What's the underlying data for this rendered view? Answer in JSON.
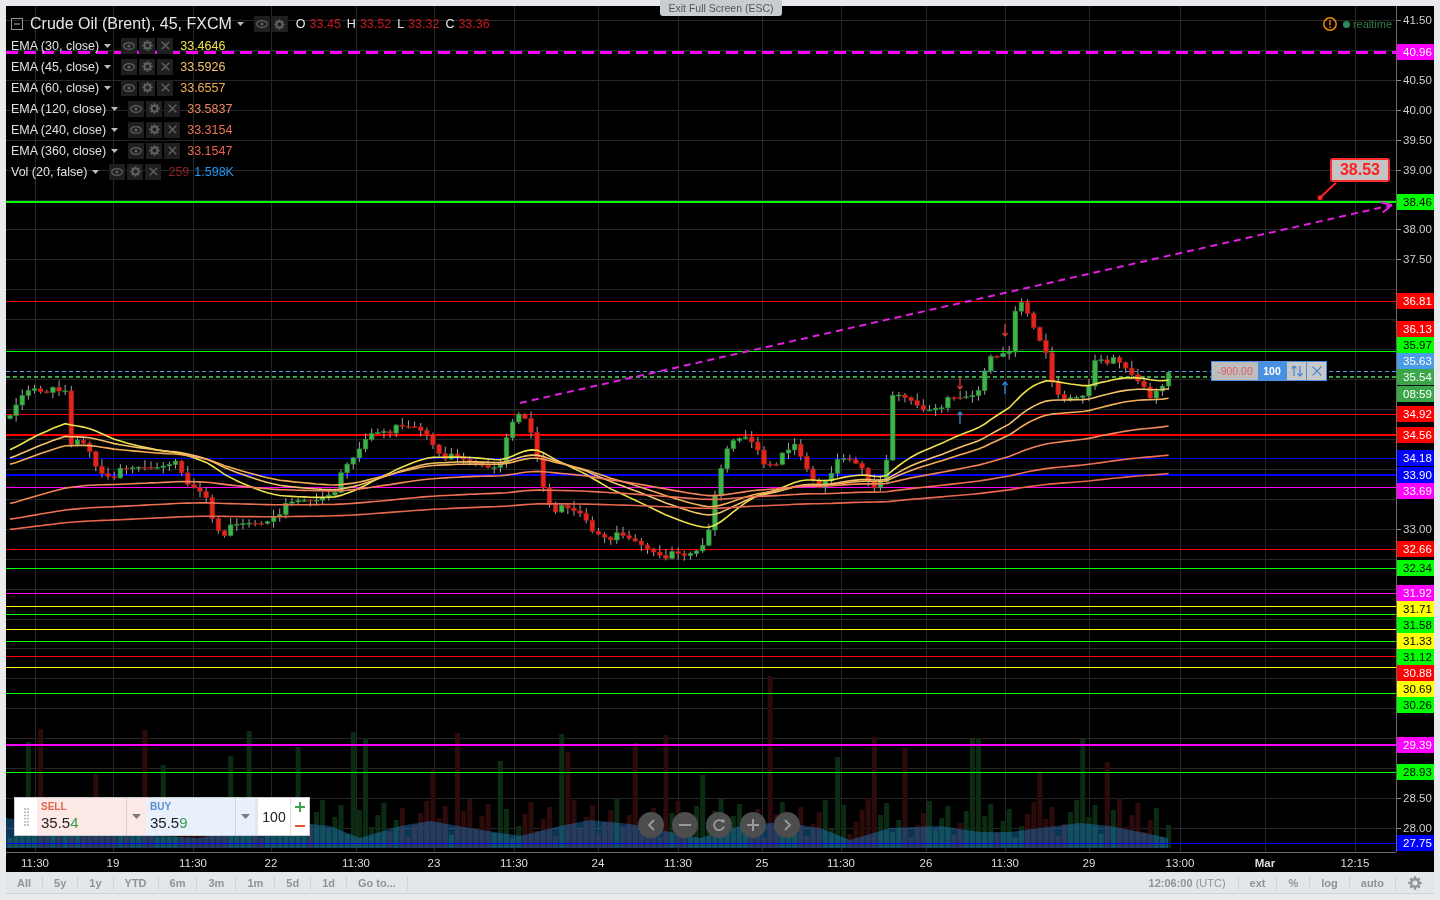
{
  "exit_fullscreen": "Exit Full Screen (ESC)",
  "legend": {
    "title": "Crude Oil (Brent), 45, FXCM",
    "ohlc": [
      {
        "label": "O",
        "value": "33.45"
      },
      {
        "label": "H",
        "value": "33.52"
      },
      {
        "label": "L",
        "value": "33.32"
      },
      {
        "label": "C",
        "value": "33.36"
      }
    ],
    "indicators": [
      {
        "name": "EMA (30, close)",
        "kind": "ema",
        "values": [
          {
            "text": "33.4646",
            "color": "#eee34a"
          }
        ]
      },
      {
        "name": "EMA (45, close)",
        "kind": "ema",
        "values": [
          {
            "text": "33.5926",
            "color": "#f4c06a"
          }
        ]
      },
      {
        "name": "EMA (60, close)",
        "kind": "ema",
        "values": [
          {
            "text": "33.6557",
            "color": "#f3ad58"
          }
        ]
      },
      {
        "name": "EMA (120, close)",
        "kind": "ema",
        "values": [
          {
            "text": "33.5837",
            "color": "#f2845a"
          }
        ]
      },
      {
        "name": "EMA (240, close)",
        "kind": "ema",
        "values": [
          {
            "text": "33.3154",
            "color": "#ee7052"
          }
        ]
      },
      {
        "name": "EMA (360, close)",
        "kind": "ema",
        "values": [
          {
            "text": "33.1547",
            "color": "#e8664e"
          }
        ]
      },
      {
        "name": "Vol (20, false)",
        "kind": "volume",
        "values": [
          {
            "text": "259",
            "color": "#8e2424"
          },
          {
            "text": "1.598K",
            "color": "#2196f3"
          }
        ]
      }
    ]
  },
  "status": {
    "text": "realtime"
  },
  "callout": {
    "text": "38.53"
  },
  "order": {
    "pnl": "-900.00",
    "quantity": "100"
  },
  "price_axis": {
    "ticks": [
      "41.50",
      "40.50",
      "40.00",
      "39.50",
      "39.00",
      "38.00",
      "37.50",
      "33.00",
      "28.50",
      "28.00"
    ]
  },
  "price_levels": [
    {
      "price": "40.96",
      "color": "#ff00ff",
      "kind": "dashed"
    },
    {
      "price": "38.46",
      "color": "#00ff00",
      "kind": "bold"
    },
    {
      "price": "36.81",
      "color": "#ff0000",
      "kind": "thin"
    },
    {
      "price": "36.13",
      "color": "#ff0000",
      "kind": "label"
    },
    {
      "price": "35.97",
      "color": "#00ff00",
      "kind": "thin"
    },
    {
      "price": "35.63",
      "color": "#4a9be6",
      "kind": "order"
    },
    {
      "price": "35.54",
      "color": "#3aa648",
      "kind": "last",
      "countdown": "08:59"
    },
    {
      "price": "34.92",
      "color": "#ff0000",
      "kind": "thin"
    },
    {
      "price": "34.56",
      "color": "#ff0000",
      "kind": "bold"
    },
    {
      "price": "34.18",
      "color": "#0000ff",
      "kind": "thin"
    },
    {
      "price": "33.90",
      "color": "#0000ff",
      "kind": "bold"
    },
    {
      "price": "33.69",
      "color": "#ff00ff",
      "kind": "thin"
    },
    {
      "price": "32.66",
      "color": "#ff0000",
      "kind": "thin"
    },
    {
      "price": "32.34",
      "color": "#00ff00",
      "kind": "thin"
    },
    {
      "price": "31.92",
      "color": "#ff00ff",
      "kind": "thin"
    },
    {
      "price": "31.71",
      "color": "#ffff00",
      "kind": "thin"
    },
    {
      "price": "31.58",
      "color": "#00ff00",
      "kind": "thin"
    },
    {
      "price": "31.33",
      "color": "#ffff00",
      "kind": "thin"
    },
    {
      "price": "31.12",
      "color": "#00ff00",
      "kind": "thin"
    },
    {
      "price": "30.88",
      "color": "#ff0000",
      "kind": "thin"
    },
    {
      "price": "30.69",
      "color": "#ffff00",
      "kind": "thin"
    },
    {
      "price": "30.26",
      "color": "#00ff00",
      "kind": "thin"
    },
    {
      "price": "29.39",
      "color": "#ff00ff",
      "kind": "bold"
    },
    {
      "price": "28.93",
      "color": "#00ff00",
      "kind": "thin"
    },
    {
      "price": "27.75",
      "color": "#0000ff",
      "kind": "thin"
    }
  ],
  "time_axis": {
    "labels": [
      {
        "text": "11:30",
        "kind": "tick"
      },
      {
        "text": "19",
        "kind": "tick"
      },
      {
        "text": "11:30",
        "kind": "tick"
      },
      {
        "text": "22",
        "kind": "tick"
      },
      {
        "text": "11:30",
        "kind": "tick"
      },
      {
        "text": "23",
        "kind": "tick"
      },
      {
        "text": "11:30",
        "kind": "tick"
      },
      {
        "text": "24",
        "kind": "tick"
      },
      {
        "text": "11:30",
        "kind": "tick"
      },
      {
        "text": "25",
        "kind": "tick"
      },
      {
        "text": "11:30",
        "kind": "tick"
      },
      {
        "text": "26",
        "kind": "tick"
      },
      {
        "text": "11:30",
        "kind": "tick"
      },
      {
        "text": "29",
        "kind": "tick"
      },
      {
        "text": "13:00",
        "kind": "tick"
      },
      {
        "text": "Mar",
        "kind": "month"
      },
      {
        "text": "12:15",
        "kind": "tick"
      }
    ]
  },
  "trade_panel": {
    "sell": {
      "label": "SELL",
      "price": "35.54"
    },
    "buy": {
      "label": "BUY",
      "price": "35.59"
    },
    "quantity": "100"
  },
  "toolbar": {
    "ranges": [
      "All",
      "5y",
      "1y",
      "YTD",
      "6m",
      "3m",
      "1m",
      "5d",
      "1d"
    ],
    "goto": "Go to...",
    "clock": "**12:06:00** (UTC)",
    "options": [
      "ext",
      "%",
      "log",
      "auto"
    ]
  }
}
